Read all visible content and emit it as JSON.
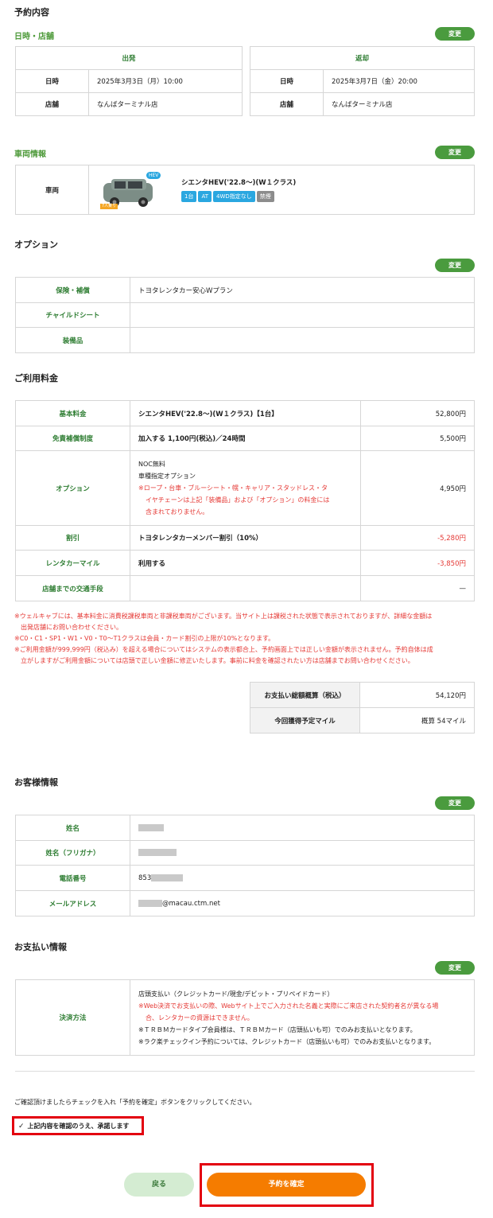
{
  "reservation": {
    "title": "予約内容",
    "datetime_store": {
      "title": "日時・店舗",
      "change": "変更",
      "departure": {
        "header": "出発",
        "date_label": "日時",
        "date": "2025年3月3日（月）10:00",
        "store_label": "店舗",
        "store": "なんばターミナル店"
      },
      "return": {
        "header": "返却",
        "date_label": "日時",
        "date": "2025年3月7日（金）20:00",
        "store_label": "店舗",
        "store": "なんばターミナル店"
      }
    },
    "vehicle": {
      "title": "車両情報",
      "change": "変更",
      "label": "車両",
      "name": "シエンタHEV('22.8～)(W１クラス)",
      "hev_badge": "HEV",
      "image_caption": "7人乗り",
      "tags": [
        "1台",
        "AT",
        "4WD指定なし",
        "禁煙"
      ]
    }
  },
  "options": {
    "title": "オプション",
    "change": "変更",
    "rows": [
      {
        "label": "保険・補償",
        "value": "トヨタレンタカー安心Wプラン"
      },
      {
        "label": "チャイルドシート",
        "value": ""
      },
      {
        "label": "装備品",
        "value": ""
      }
    ]
  },
  "fees": {
    "title": "ご利用料金",
    "rows": [
      {
        "label": "基本料金",
        "desc": "シエンタHEV('22.8～)(W１クラス)【1台】",
        "amount": "52,800円"
      },
      {
        "label": "免責補償制度",
        "desc": "加入する 1,100円(税込)／24時間",
        "amount": "5,500円"
      },
      {
        "label": "オプション",
        "desc1": "NOC無料",
        "desc2": "車種指定オプション",
        "desc3": "※ロープ・台車・ブルーシート・幌・キャリア・スタッドレス・タ",
        "desc4": "イヤチェーンは上記「装備品」および「オプション」の料金には",
        "desc5": "含まれておりません。",
        "amount": "4,950円"
      },
      {
        "label": "割引",
        "desc": "トヨタレンタカーメンバー割引（10%）",
        "amount": "-5,280円"
      },
      {
        "label": "レンタカーマイル",
        "desc": "利用する",
        "amount": "-3,850円"
      },
      {
        "label": "店舗までの交通手段",
        "desc": "",
        "amount": "—"
      }
    ],
    "notes": [
      "※ウェルキャブには、基本料金に消費税課税車両と非課税車両がございます。当サイト上は課税された状態で表示されておりますが、詳細な金額は",
      "出発店舗にお問い合わせください。",
      "※C0・C1・SP1・W1・V0・T0～T1クラスは会員・カード割引の上限が10%となります。",
      "※ご利用金額が999,999円（税込み）を超える場合についてはシステムの表示都合上、予約画面上では正しい金額が表示されません。予約自体は成",
      "立がしますがご利用金額については店頭で正しい金額に修正いたします。事前に料金を確認されたい方は店舗までお問い合わせください。"
    ],
    "total_label": "お支払い総額概算（税込）",
    "total_value": "54,120円",
    "mile_label": "今回獲得予定マイル",
    "mile_value": "概算 54マイル"
  },
  "customer": {
    "title": "お客様情報",
    "change": "変更",
    "name_label": "姓名",
    "kana_label": "姓名（フリガナ）",
    "phone_label": "電話番号",
    "phone_prefix": "853",
    "email_label": "メールアドレス",
    "email_suffix": "@macau.ctm.net"
  },
  "payment": {
    "title": "お支払い情報",
    "change": "変更",
    "label": "決済方法",
    "line1": "店頭支払い（クレジットカード/現金/デビット・プリペイドカード）",
    "line2": "※Web決済でお支払いの際、Webサイト上でご入力された名義と実際にご来店された契約者名が異なる場",
    "line3": "合、レンタカーの資源はできません。",
    "line4": "※ＴＲＢＭカードタイプ会員様は、ＴＲＢＭカード（店頭払いも可）でのみお支払いとなります。",
    "line5": "※ラク楽チェックイン予約については、クレジットカード（店頭払いも可）でのみお支払いとなります。"
  },
  "confirm": {
    "instruction": "ご確認頂けましたらチェックを入れ「予約を確定」ボタンをクリックしてください。",
    "checkbox_label": "上記内容を確認のうえ、承諾します",
    "back": "戻る",
    "submit": "予約を確定"
  },
  "colors": {
    "green_button": "#4a9b3e",
    "green_text": "#2e7d32",
    "orange": "#f57c00",
    "red_note": "#e53935",
    "highlight_box": "#e3000f",
    "tag_blue": "#2aa7e0",
    "tag_gray": "#8c8c8c"
  }
}
